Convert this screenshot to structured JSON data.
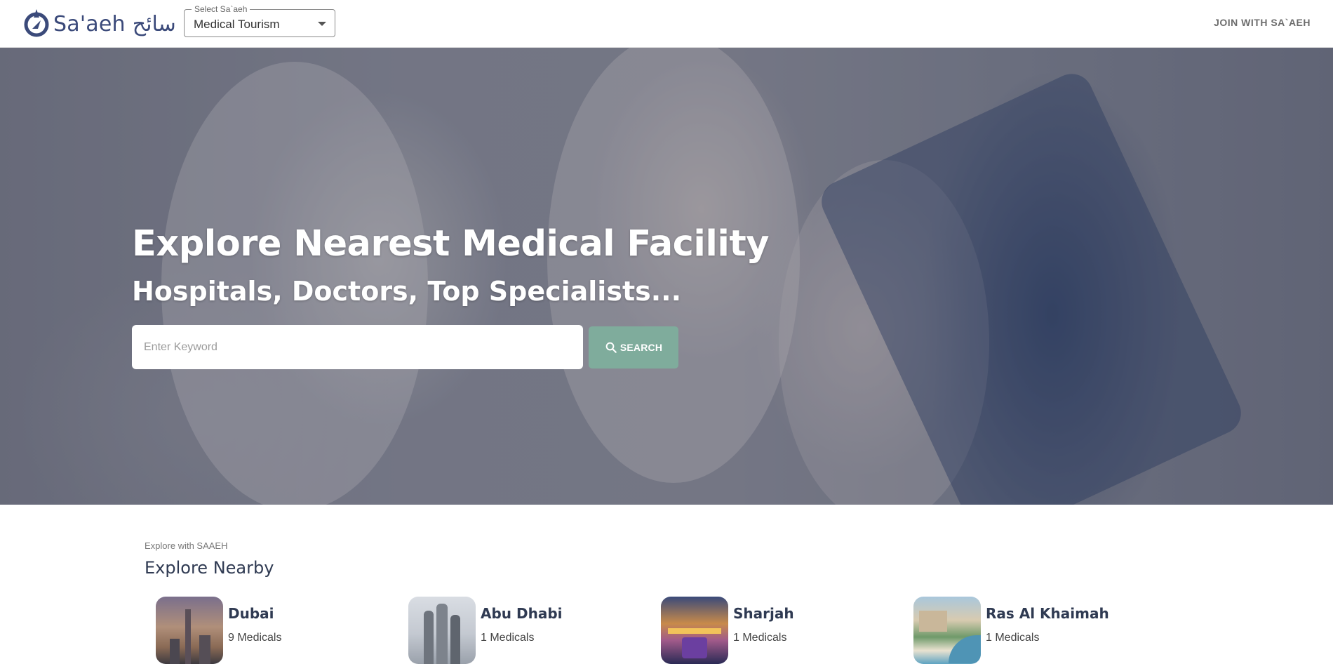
{
  "header": {
    "logo_text": "Sa'aeh",
    "logo_arabic": "سائح",
    "select": {
      "label": "Select Sa`aeh",
      "value": "Medical Tourism"
    },
    "join_label": "JOIN WITH SA`AEH"
  },
  "hero": {
    "title": "Explore Nearest Medical Facility",
    "subtitle": "Hospitals, Doctors, Top Specialists...",
    "search_placeholder": "Enter Keyword",
    "search_button_label": "SEARCH"
  },
  "explore": {
    "kicker": "Explore with SAAEH",
    "title": "Explore Nearby",
    "cities": [
      {
        "name": "Dubai",
        "count": "9 Medicals"
      },
      {
        "name": "Abu Dhabi",
        "count": "1 Medicals"
      },
      {
        "name": "Sharjah",
        "count": "1 Medicals"
      },
      {
        "name": "Ras Al Khaimah",
        "count": "1 Medicals"
      }
    ]
  },
  "colors": {
    "brand": "#3b4a7a",
    "search_button": "#7fac9c",
    "heading_text": "#2f3a52"
  },
  "icons": [
    "brand-logo-icon",
    "chevron-down-icon",
    "search-icon"
  ]
}
